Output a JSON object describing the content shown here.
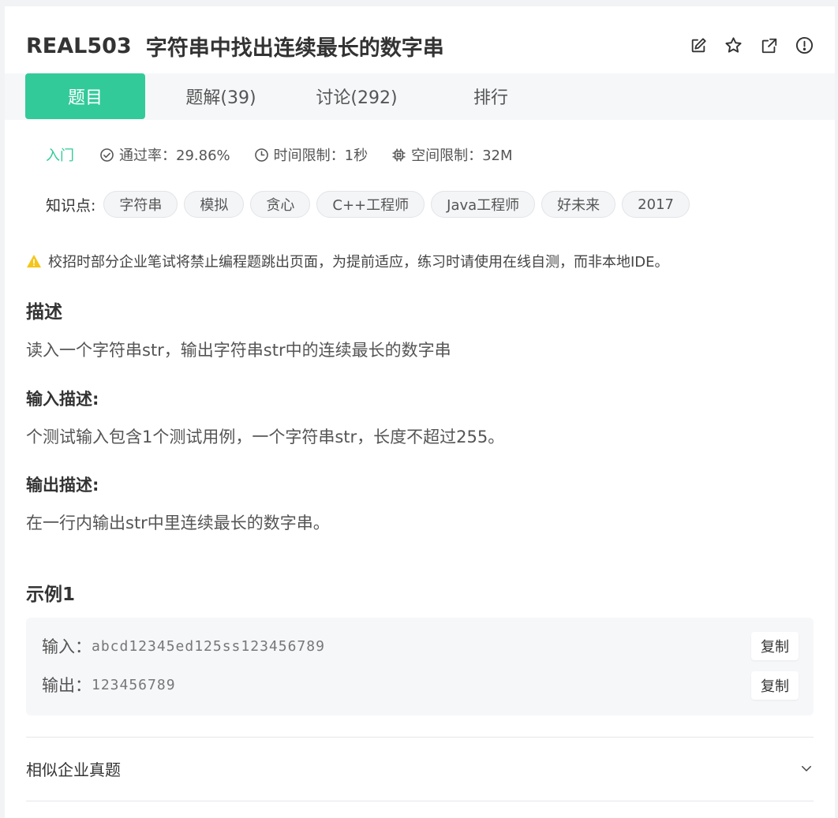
{
  "header": {
    "code": "REAL503",
    "title": "字符串中找出连续最长的数字串",
    "icons": [
      "edit-icon",
      "star-icon",
      "share-icon",
      "report-icon"
    ]
  },
  "tabs": [
    {
      "label": "题目",
      "active": true
    },
    {
      "label": "题解(39)",
      "active": false
    },
    {
      "label": "讨论(292)",
      "active": false
    },
    {
      "label": "排行",
      "active": false
    }
  ],
  "meta": {
    "level": "入门",
    "pass_rate": "通过率：29.86%",
    "time_limit": "时间限制：1秒",
    "space_limit": "空间限制：32M"
  },
  "knowledge": {
    "label": "知识点:",
    "tags": [
      "字符串",
      "模拟",
      "贪心",
      "C++工程师",
      "Java工程师",
      "好未来",
      "2017"
    ]
  },
  "notice": "校招时部分企业笔试将禁止编程题跳出页面，为提前适应，练习时请使用在线自测，而非本地IDE。",
  "description": {
    "heading": "描述",
    "text": "读入一个字符串str，输出字符串str中的连续最长的数字串"
  },
  "input_desc": {
    "heading": "输入描述:",
    "text": "个测试输入包含1个测试用例，一个字符串str，长度不超过255。"
  },
  "output_desc": {
    "heading": "输出描述:",
    "text": "在一行内输出str中里连续最长的数字串。"
  },
  "example": {
    "heading": "示例1",
    "input_label": "输入：",
    "input_value": "abcd12345ed125ss123456789",
    "output_label": "输出：",
    "output_value": "123456789",
    "copy_label": "复制"
  },
  "similar": {
    "label": "相似企业真题"
  },
  "colors": {
    "accent": "#32ca99",
    "warning": "#f5c518"
  }
}
